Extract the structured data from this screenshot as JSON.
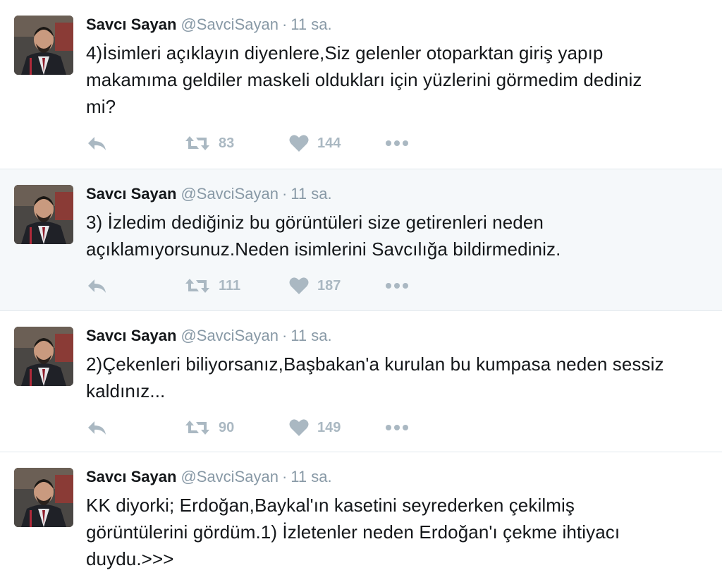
{
  "tweets": [
    {
      "name": "Savcı Sayan",
      "handle": "@SavciSayan",
      "separator": "·",
      "time": "11 sa.",
      "text": "4)İsimleri açıklayın diyenlere,Siz gelenler otoparktan giriş yapıp\nmakamıma geldiler maskeli oldukları için yüzlerini görmedim dediniz\nmi?",
      "retweets": "83",
      "likes": "144"
    },
    {
      "name": "Savcı Sayan",
      "handle": "@SavciSayan",
      "separator": "·",
      "time": "11 sa.",
      "text": "3) İzledim dediğiniz bu görüntüleri size getirenleri neden\naçıklamıyorsunuz.Neden isimlerini Savcılığa bildirmediniz.",
      "retweets": "111",
      "likes": "187"
    },
    {
      "name": "Savcı Sayan",
      "handle": "@SavciSayan",
      "separator": "·",
      "time": "11 sa.",
      "text": "2)Çekenleri biliyorsanız,Başbakan'a kurulan bu kumpasa neden sessiz\nkaldınız...",
      "retweets": "90",
      "likes": "149"
    },
    {
      "name": "Savcı Sayan",
      "handle": "@SavciSayan",
      "separator": "·",
      "time": "11 sa.",
      "text": "KK diyorki; Erdoğan,Baykal'ın kasetini seyrederken çekilmiş\ngörüntülerini gördüm.1) İzletenler neden Erdoğan'ı çekme ihtiyacı\nduydu.>>>"
    }
  ],
  "icons": {
    "reply": "reply-icon",
    "retweet": "retweet-icon",
    "like": "heart-icon",
    "more": "more-icon"
  },
  "colors": {
    "action_gray": "#aab8c2",
    "meta_gray": "#8899a6",
    "highlight_bg": "#f5f8fa",
    "divider": "#e1e8ed"
  }
}
